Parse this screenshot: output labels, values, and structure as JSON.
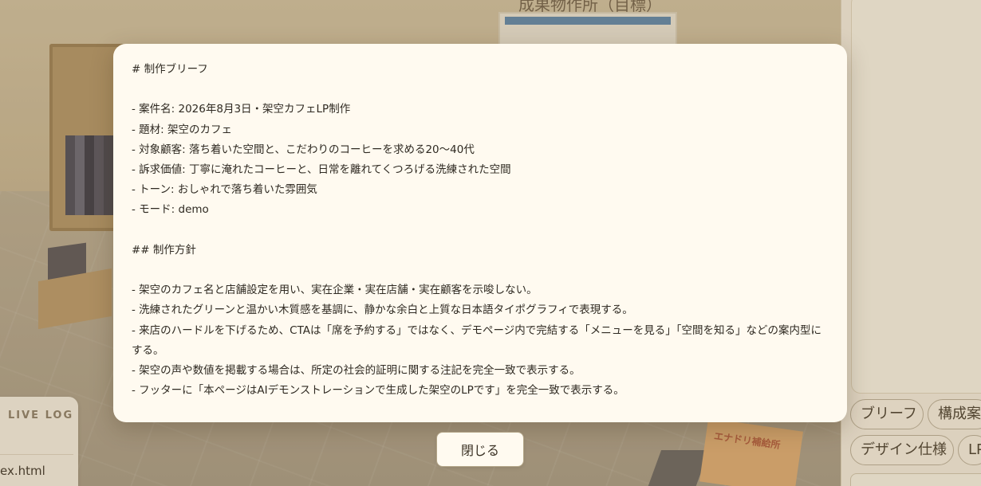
{
  "brief_modal": {
    "text": "# 制作ブリーフ\n\n- 案件名: 2026年8月3日・架空カフェLP制作\n- 題材: 架空のカフェ\n- 対象顧客: 落ち着いた空間と、こだわりのコーヒーを求める20〜40代\n- 訴求価値: 丁寧に淹れたコーヒーと、日常を離れてくつろげる洗練された空間\n- トーン: おしゃれで落ち着いた雰囲気\n- モード: demo\n\n## 制作方針\n\n- 架空のカフェ名と店舗設定を用い、実在企業・実在店舗・実在顧客を示唆しない。\n- 洗練されたグリーンと温かい木質感を基調に、静かな余白と上質な日本語タイポグラフィで表現する。\n- 来店のハードルを下げるため、CTAは「席を予約する」ではなく、デモページ内で完結する「メニューを見る」「空間を知る」などの案内型にする。\n- 架空の声や数値を掲載する場合は、所定の社会的証明に関する注記を完全一致で表示する。\n- フッターに「本ページはAIデモンストレーションで生成した架空のLPです」を完全一致で表示する。",
    "close_label": "閉じる"
  },
  "right_panel": {
    "tabs": [
      {
        "label": "ブリーフ"
      },
      {
        "label": "構成案"
      },
      {
        "label": "デザイン仕様"
      },
      {
        "label": "LP"
      }
    ]
  },
  "live_log": {
    "title": "LIVE LOG",
    "file": "ex.html"
  },
  "scene": {
    "wall_sign": "成果物作所（目標）",
    "floor_sign": "エナドリ補給所"
  },
  "colors": {
    "modal_bg": "#fffaf0",
    "page_bg": "#c4b28d",
    "text": "#2f2a22"
  }
}
